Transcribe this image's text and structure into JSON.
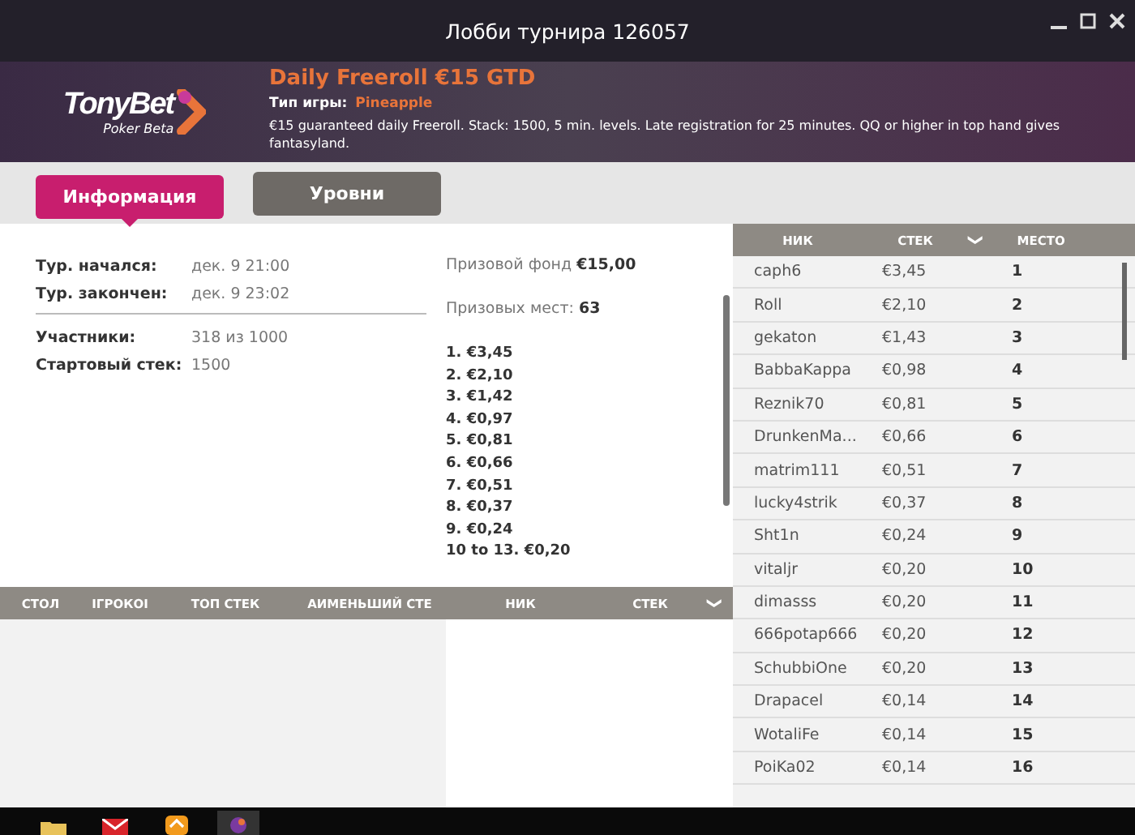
{
  "window": {
    "title": "Лобби турнира 126057"
  },
  "header": {
    "logo": "TonyBet",
    "logo_sub": "Poker Beta",
    "title": "Daily Freeroll €15 GTD",
    "game_type_label": "Тип игры:",
    "game_type": "Pineapple",
    "description": "€15 guaranteed daily Freeroll. Stack: 1500, 5 min. levels. Late registration for 25 minutes. QQ or higher in top hand gives fantasyland."
  },
  "tabs": [
    {
      "label": "Информация",
      "selected": true
    },
    {
      "label": "Уровни",
      "selected": false
    }
  ],
  "info": [
    {
      "label": "Тур. начался:",
      "value": "дек. 9 21:00"
    },
    {
      "label": "Тур. закончен:",
      "value": "дек. 9 23:02"
    },
    {
      "label": "Участники:",
      "value": "318 из 1000"
    },
    {
      "label": "Стартовый стек:",
      "value": "1500"
    }
  ],
  "prize_fund": {
    "label": "Призовой фонд",
    "value": "€15,00"
  },
  "prize_places": {
    "label": "Призовых мест:",
    "value": "63"
  },
  "payouts": [
    "1. €3,45",
    "2. €2,10",
    "3. €1,42",
    "4. €0,97",
    "5. €0,81",
    "6. €0,66",
    "7. €0,51",
    "8. €0,37",
    "9. €0,24",
    "10 to 13. €0,20"
  ],
  "tables": {
    "columns": [
      "СТОЛ",
      "ІГРОКОІ",
      "ТОП СТЕК",
      "АИМЕНЬШИЙ СТЕ"
    ]
  },
  "table_players": {
    "columns": [
      "НИК",
      "СТЕК"
    ],
    "sort_icon": "❯"
  },
  "players": {
    "columns": [
      "НИК",
      "СТЕК",
      "МЕСТО"
    ],
    "sort_icon": "❯",
    "rows": [
      {
        "nick": "caph6",
        "stack": "€3,45",
        "place": "1"
      },
      {
        "nick": "Roll",
        "stack": "€2,10",
        "place": "2"
      },
      {
        "nick": "gekaton",
        "stack": "€1,43",
        "place": "3"
      },
      {
        "nick": "BabbaKappa",
        "stack": "€0,98",
        "place": "4"
      },
      {
        "nick": "Reznik70",
        "stack": "€0,81",
        "place": "5"
      },
      {
        "nick": "DrunkenMa...",
        "stack": "€0,66",
        "place": "6"
      },
      {
        "nick": "matrim111",
        "stack": "€0,51",
        "place": "7"
      },
      {
        "nick": "lucky4strik",
        "stack": "€0,37",
        "place": "8"
      },
      {
        "nick": "Sht1n",
        "stack": "€0,24",
        "place": "9"
      },
      {
        "nick": "vitaljr",
        "stack": "€0,20",
        "place": "10"
      },
      {
        "nick": "dimasss",
        "stack": "€0,20",
        "place": "11"
      },
      {
        "nick": "666potap666",
        "stack": "€0,20",
        "place": "12"
      },
      {
        "nick": "SchubbiOne",
        "stack": "€0,20",
        "place": "13"
      },
      {
        "nick": "Drapacel",
        "stack": "€0,14",
        "place": "14"
      },
      {
        "nick": "WotaliFe",
        "stack": "€0,14",
        "place": "15"
      },
      {
        "nick": "PoiKa02",
        "stack": "€0,14",
        "place": "16"
      }
    ]
  },
  "taskbar": [
    {
      "kind": "folder",
      "selected": false
    },
    {
      "kind": "mail",
      "selected": false
    },
    {
      "kind": "app",
      "selected": false
    },
    {
      "kind": "poker",
      "selected": true
    }
  ]
}
